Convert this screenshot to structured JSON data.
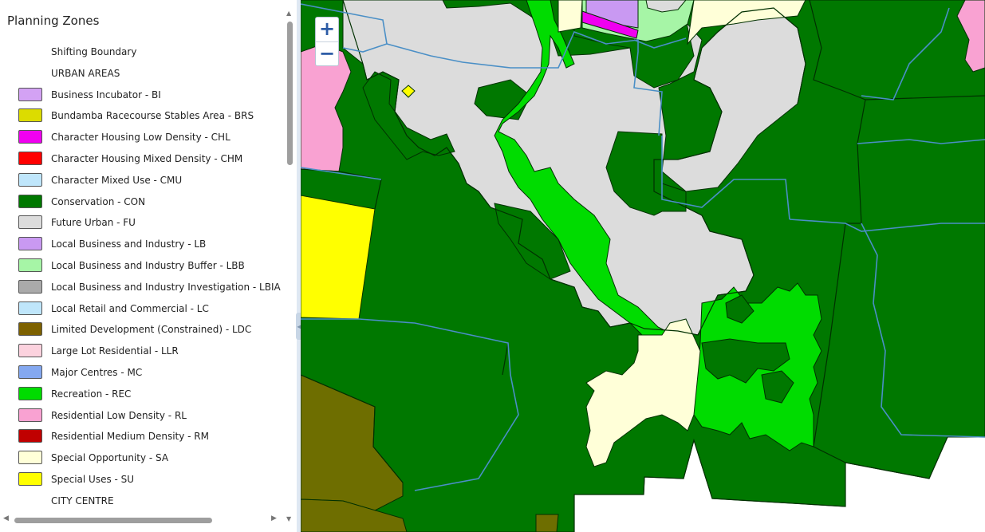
{
  "legend": {
    "title": "Planning Zones",
    "items": [
      {
        "label": "Shifting Boundary",
        "color": ""
      },
      {
        "label": "URBAN AREAS",
        "color": ""
      },
      {
        "label": "Business Incubator - BI",
        "color": "#d3a2f4"
      },
      {
        "label": "Bundamba Racecourse Stables Area - BRS",
        "color": "#dcdc00"
      },
      {
        "label": "Character Housing Low Density - CHL",
        "color": "#f000f0"
      },
      {
        "label": "Character Housing Mixed Density - CHM",
        "color": "#ff0000"
      },
      {
        "label": "Character Mixed Use - CMU",
        "color": "#bfe6fb"
      },
      {
        "label": "Conservation - CON",
        "color": "#007800"
      },
      {
        "label": "Future Urban - FU",
        "color": "#dcdcdc"
      },
      {
        "label": "Local Business and Industry - LB",
        "color": "#c999f2"
      },
      {
        "label": "Local Business and Industry Buffer - LBB",
        "color": "#a6f5a6"
      },
      {
        "label": "Local Business and Industry Investigation - LBIA",
        "color": "#aaaaaa"
      },
      {
        "label": "Local Retail and Commercial - LC",
        "color": "#bfe6fb"
      },
      {
        "label": "Limited Development (Constrained) - LDC",
        "color": "#7d6100"
      },
      {
        "label": "Large Lot Residential - LLR",
        "color": "#fcd2de"
      },
      {
        "label": "Major Centres - MC",
        "color": "#84a8f0"
      },
      {
        "label": "Recreation - REC",
        "color": "#00dc00"
      },
      {
        "label": "Residential Low Density - RL",
        "color": "#f9a2d2"
      },
      {
        "label": "Residential Medium Density - RM",
        "color": "#c00000"
      },
      {
        "label": "Special Opportunity - SA",
        "color": "#ffffd8"
      },
      {
        "label": "Special Uses - SU",
        "color": "#ffff00"
      },
      {
        "label": "CITY CENTRE",
        "color": ""
      }
    ]
  },
  "map": {
    "zoom_in_label": "+",
    "zoom_out_label": "−",
    "colors": {
      "conservation": "#007800",
      "future_urban": "#dcdcdc",
      "recreation": "#00dc00",
      "special_opportunity": "#ffffd8",
      "special_uses": "#ffff00",
      "limited_development": "#6e6e00",
      "residential_low": "#f9a2d2",
      "local_business": "#c999f2",
      "lbb": "#a6f5a6",
      "chl": "#f000f0",
      "boundary": "#4a8fc6"
    }
  }
}
